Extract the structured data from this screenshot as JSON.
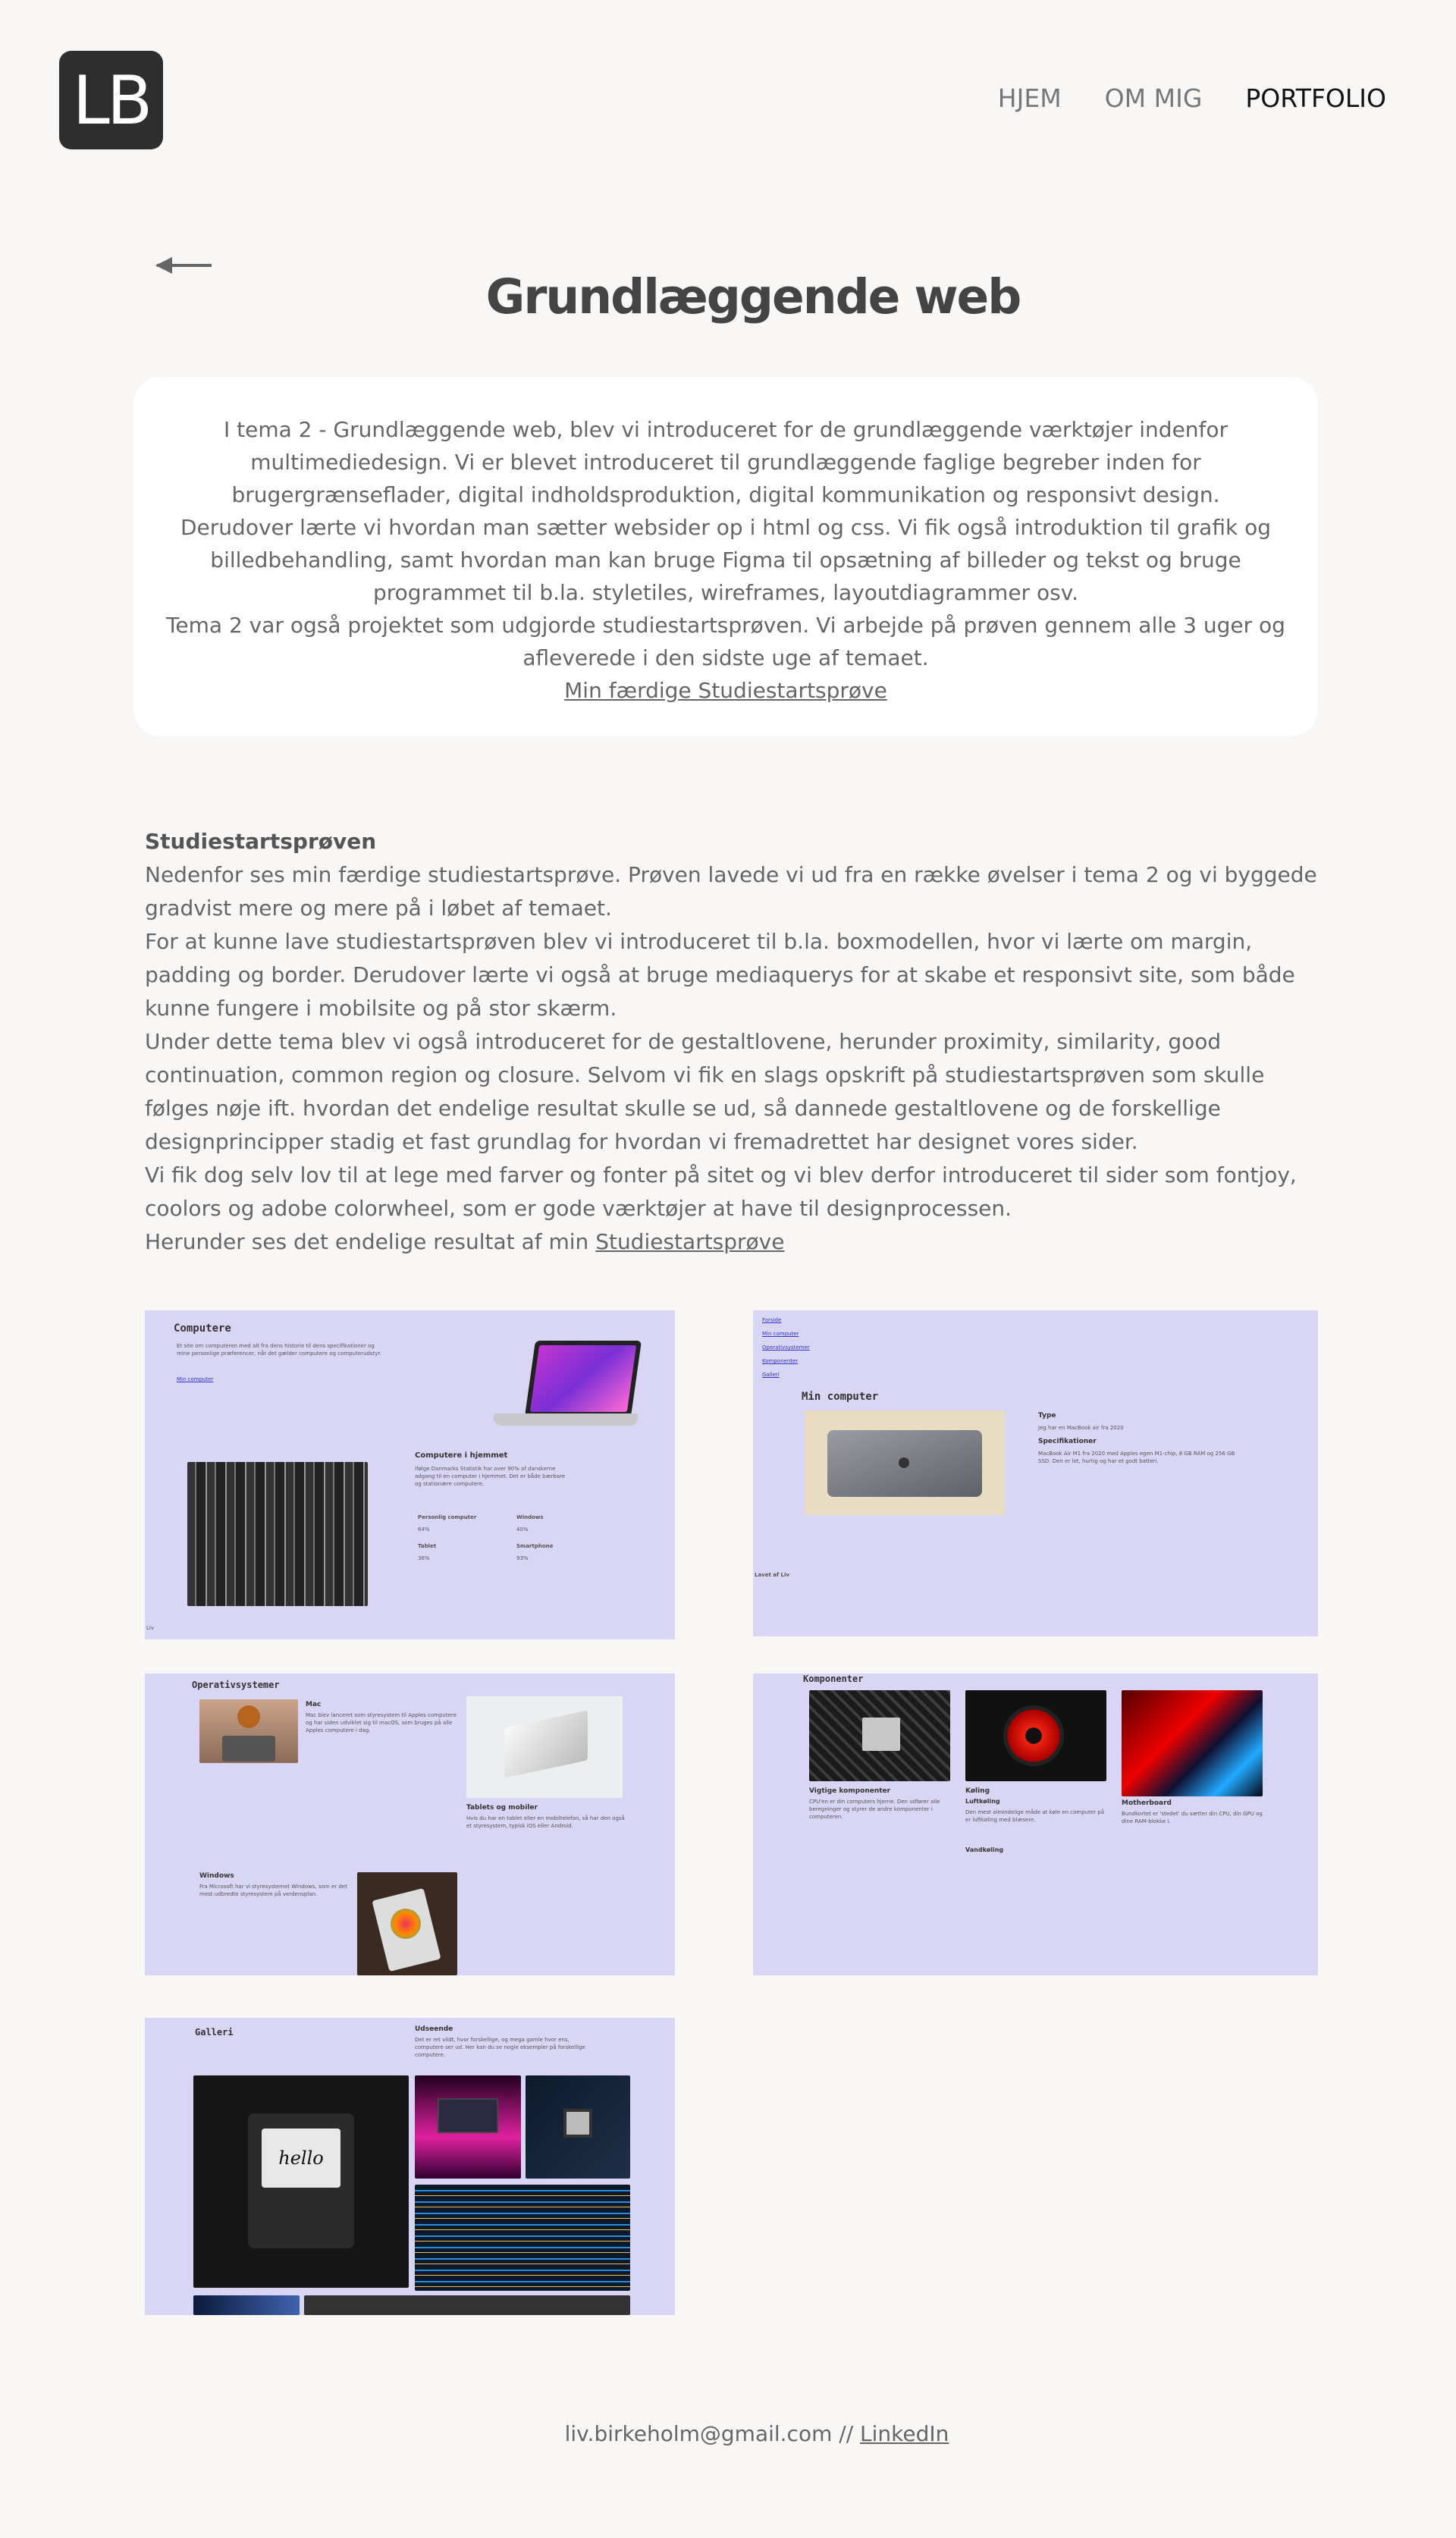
{
  "header": {
    "logo_text": "LB",
    "nav": [
      {
        "label": "HJEM"
      },
      {
        "label": "OM MIG"
      },
      {
        "label": "PORTFOLIO"
      }
    ]
  },
  "page": {
    "title": "Grundlæggende web",
    "intro_paragraphs": [
      "I tema 2 - Grundlæggende web, blev vi introduceret for de grundlæggende værktøjer indenfor multimediedesign. Vi er blevet introduceret til grundlæggende faglige begreber inden for brugergrænseflader, digital indholdsproduktion, digital kommunikation og responsivt design.",
      "Derudover lærte vi hvordan man sætter websider op i html og css. Vi fik også introduktion til grafik og billedbehandling, samt hvordan man kan bruge Figma til opsætning af billeder og tekst og bruge programmet til b.la. styletiles, wireframes, layoutdiagrammer osv.",
      "Tema 2 var også projektet som udgjorde studiestartsprøven. Vi arbejde på prøven gennem alle 3 uger og afleverede i den sidste uge af temaet."
    ],
    "intro_link": "Min færdige Studiestartsprøve",
    "section_heading": "Studiestartsprøven",
    "section_paragraphs": [
      "Nedenfor ses min færdige studiestartsprøve. Prøven lavede vi ud fra en række øvelser i tema 2 og vi byggede gradvist mere og mere på i løbet af temaet.",
      "For at kunne lave studiestartsprøven blev vi introduceret til b.la. boxmodellen, hvor vi lærte om margin, padding og border. Derudover lærte vi også at bruge mediaquerys for at skabe et responsivt site, som både kunne fungere i mobilsite og på stor skærm.",
      "Under dette tema blev vi også introduceret for de gestaltlovene, herunder proximity, similarity, good continuation, common region og closure. Selvom vi fik en slags opskrift på studiestartsprøven som skulle følges nøje ift. hvordan det endelige resultat skulle se ud, så dannede gestaltlovene og de forskellige designprincipper stadig et fast grundlag for hvordan vi fremadrettet har designet vores sider.",
      "Vi fik dog selv lov til at lege med farver og fonter på sitet og vi blev derfor introduceret til sider som fontjoy, coolors og adobe colorwheel, som er gode værktøjer at have til designprocessen."
    ],
    "final_line_prefix": "Herunder ses det endelige resultat af min",
    "final_line_link": "Studiestartsprøve"
  },
  "gallery": {
    "shot1": {
      "title": "Computere",
      "text": "Et site om computeren med alt fra dens historie til dens specifikationer og mine personlige præferencer, når det gælder computere og computerudstyr.",
      "link": "Min computer",
      "sub": "Computere i hjemmet",
      "sub_text": "Ifølge Danmarks Statistik har over 90% af danskerne adgang til en computer i hjemmet. Det er både bærbare og stationære computere.",
      "table": [
        [
          "Personlig computer",
          "Windows"
        ],
        [
          "64%",
          "40%"
        ],
        [
          "Tablet",
          "Smartphone"
        ],
        [
          "36%",
          "93%"
        ]
      ],
      "footer": "Liv"
    },
    "shot2": {
      "links": [
        "Forside",
        "Min computer",
        "Operativsystemer",
        "Komponenter",
        "Galleri"
      ],
      "title": "Min computer",
      "type_label": "Type",
      "type_text": "Jeg har en MacBook air fra 2020",
      "spec_label": "Specifikationer",
      "spec_text": "MacBook Air M1 fra 2020 med Apples egen M1-chip, 8 GB RAM og 256 GB SSD. Den er let, hurtig og har et godt batteri.",
      "footer": "Lavet af Liv"
    },
    "shot3": {
      "title": "Operativsystemer",
      "mac": "Mac",
      "mac_text": "Mac blev lanceret som styresystem til Apples computere og har siden udviklet sig til macOS, som bruges på alle Apples computere i dag.",
      "windows": "Windows",
      "windows_text": "Fra Microsoft har vi styresystemet Windows, som er det mest udbredte styresystem på verdensplan.",
      "tablets": "Tablets og mobiler",
      "tablets_text": "Hvis du har en tablet eller en mobiltelefon, så har den også et styresystem, typisk iOS eller Android."
    },
    "shot4": {
      "title": "Komponenter",
      "c1": "Vigtige komponenter",
      "c1_text": "CPU'en er din computers hjerne. Den udfører alle beregninger og styrer de andre komponenter i computeren.",
      "c2": "Køling",
      "c2_sub": "Luftkøling",
      "c2_text": "Den mest almindelige måde at køle en computer på er luftkøling med blæsere.",
      "c2_sub2": "Vandkøling",
      "c3": "Motherboard",
      "c3_text": "Bundkortet er 'stedet' du sætter din CPU, din GPU og dine RAM-blokke i."
    },
    "shot5": {
      "title": "Galleri",
      "sub": "Udseende",
      "sub_text": "Det er ret vildt, hvor forskellige, og mega gamle hvor ens, computere ser ud. Her kan du se nogle eksempler på forskellige computere.",
      "hello": "hello"
    }
  },
  "footer": {
    "email_text": "liv.birkeholm@gmail.com //",
    "link": "LinkedIn"
  }
}
